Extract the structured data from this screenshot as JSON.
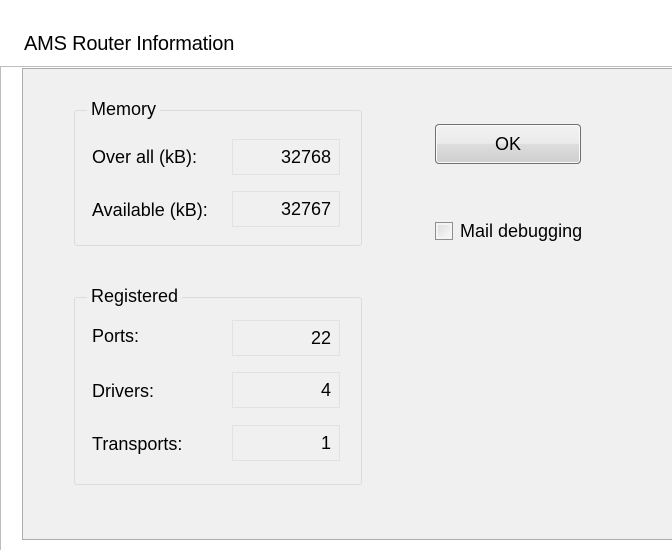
{
  "window": {
    "title": "AMS Router Information"
  },
  "memory": {
    "legend": "Memory",
    "overall_label": "Over all (kB):",
    "overall_value": "32768",
    "available_label": "Available (kB):",
    "available_value": "32767"
  },
  "registered": {
    "legend": "Registered",
    "ports_label": "Ports:",
    "ports_value": "22",
    "drivers_label": "Drivers:",
    "drivers_value": "4",
    "transports_label": "Transports:",
    "transports_value": "1"
  },
  "actions": {
    "ok_label": "OK"
  },
  "options": {
    "mail_debugging_label": "Mail debugging",
    "mail_debugging_checked": false
  }
}
